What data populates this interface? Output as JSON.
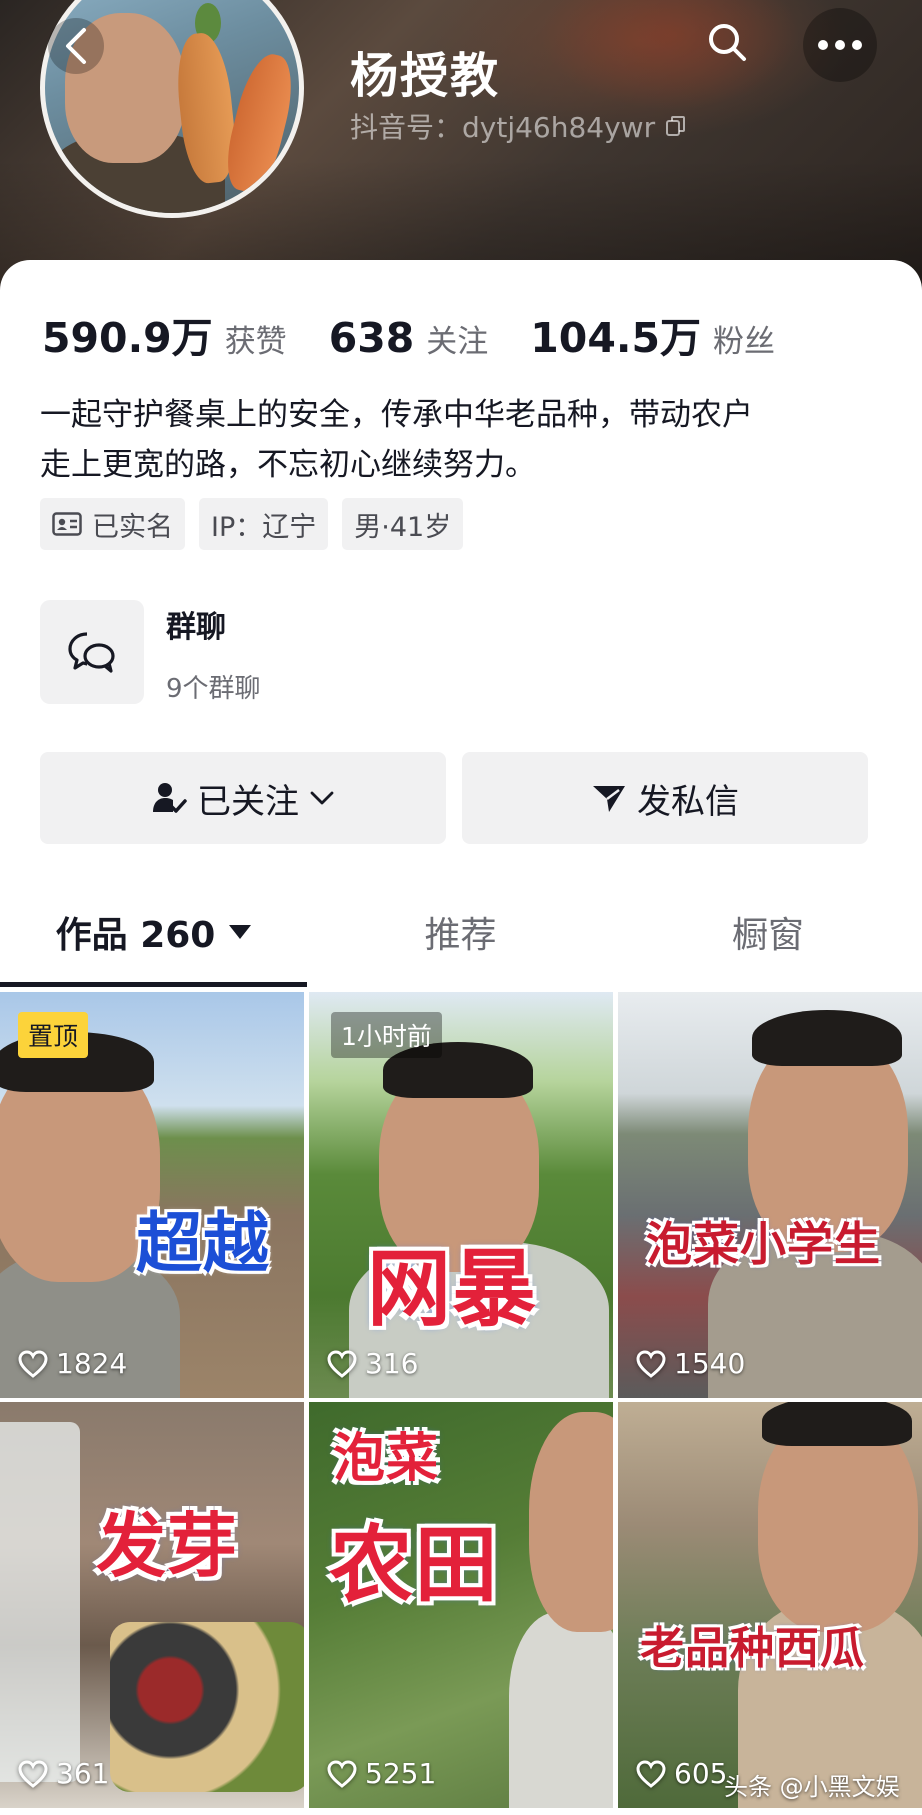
{
  "profile": {
    "name": "杨授教",
    "douyin_id": "抖音号：dytj46h84ywr",
    "stats": [
      {
        "num": "590.9万",
        "label": "获赞"
      },
      {
        "num": "638",
        "label": "关注"
      },
      {
        "num": "104.5万",
        "label": "粉丝"
      }
    ],
    "bio_line1": "一起守护餐桌上的安全，传承中华老品种，带动农户",
    "bio_line2": "走上更宽的路，不忘初心继续努力。",
    "tags": [
      "已实名",
      "IP：辽宁",
      "男·41岁"
    ]
  },
  "group_chat": {
    "title": "群聊",
    "subtitle": "9个群聊"
  },
  "actions": {
    "follow_label": "已关注",
    "message_label": "发私信"
  },
  "tabs": {
    "works": "作品 260",
    "recommend": "推荐",
    "window": "橱窗"
  },
  "videos": [
    {
      "caption": "超越",
      "likes": "1824",
      "badge": "置顶"
    },
    {
      "caption": "网暴",
      "likes": "316",
      "badge": "1小时前"
    },
    {
      "caption": "泡菜小学生",
      "likes": "1540"
    },
    {
      "caption": "发芽",
      "likes": "361"
    },
    {
      "caption_top": "泡菜",
      "caption": "农田",
      "likes": "5251"
    },
    {
      "caption": "老品种西瓜",
      "likes": "605"
    }
  ],
  "watermark": "头条 @小黑文娱",
  "colors": {
    "pin_badge": "#fcd33a",
    "caption_blue": "#1c4fd6",
    "caption_red": "#e3213a",
    "tab_active": "#161823"
  }
}
